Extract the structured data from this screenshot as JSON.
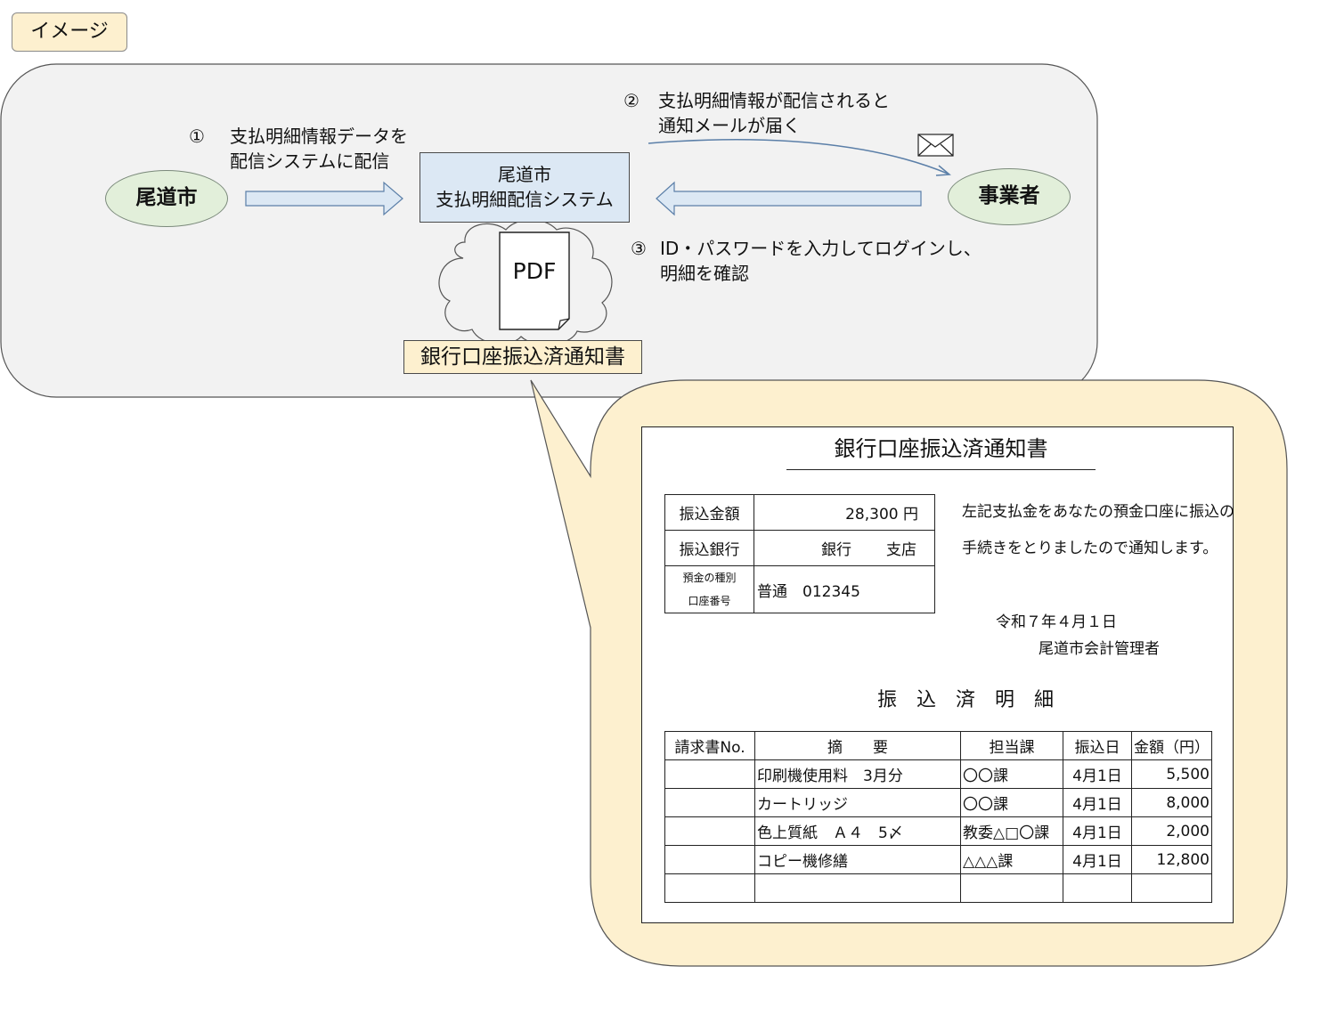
{
  "image_tag": "イメージ",
  "nodes": {
    "city": "尾道市",
    "system_line1": "尾道市",
    "system_line2": "支払明細配信システム",
    "business": "事業者"
  },
  "steps": {
    "step1": {
      "num": "①",
      "line1": "支払明細情報データを",
      "line2": "配信システムに配信"
    },
    "step2": {
      "num": "②",
      "line1": "支払明細情報が配信されると",
      "line2": "通知メールが届く"
    },
    "step3": {
      "num": "③",
      "line1": "ID・パスワードを入力してログインし、",
      "line2": "明細を確認"
    }
  },
  "pdf_label": "PDF",
  "document_label": "銀行口座振込済通知書",
  "notice": {
    "title": "銀行口座振込済通知書",
    "amount_label": "振込金額",
    "amount_value": "28,300 円",
    "bank_label": "振込銀行",
    "bank_value_bank": "銀行",
    "bank_value_branch": "支店",
    "account_label_line1": "預金の種別",
    "account_label_line2": "口座番号",
    "account_value": "普通　012345",
    "message_line1": "左記支払金をあなたの預金口座に振込の",
    "message_line2": "手続きをとりましたので通知します。",
    "date": "令和７年４月１日",
    "issuer": "尾道市会計管理者",
    "detail_title": "振　込　済　明　細",
    "columns": [
      "請求書No.",
      "摘　　要",
      "担当課",
      "振込日",
      "金額（円）"
    ],
    "rows": [
      [
        "",
        "印刷機使用料　3月分",
        "〇〇課",
        "4月1日",
        "5,500"
      ],
      [
        "",
        "カートリッジ",
        "〇〇課",
        "4月1日",
        "8,000"
      ],
      [
        "",
        "色上質紙　Ａ４　5〆",
        "教委△□〇課",
        "4月1日",
        "2,000"
      ],
      [
        "",
        "コピー機修繕",
        "△△△課",
        "4月1日",
        "12,800"
      ],
      [
        "",
        "",
        "",
        "",
        ""
      ]
    ]
  },
  "colors": {
    "panel_fill": "#f2f2f2",
    "callout_fill": "#fdf0cf",
    "node_fill": "#e2efda",
    "system_fill": "#dce8f4",
    "arrow_fill": "#dce8f4",
    "arrow_stroke": "#5b7fa8"
  }
}
